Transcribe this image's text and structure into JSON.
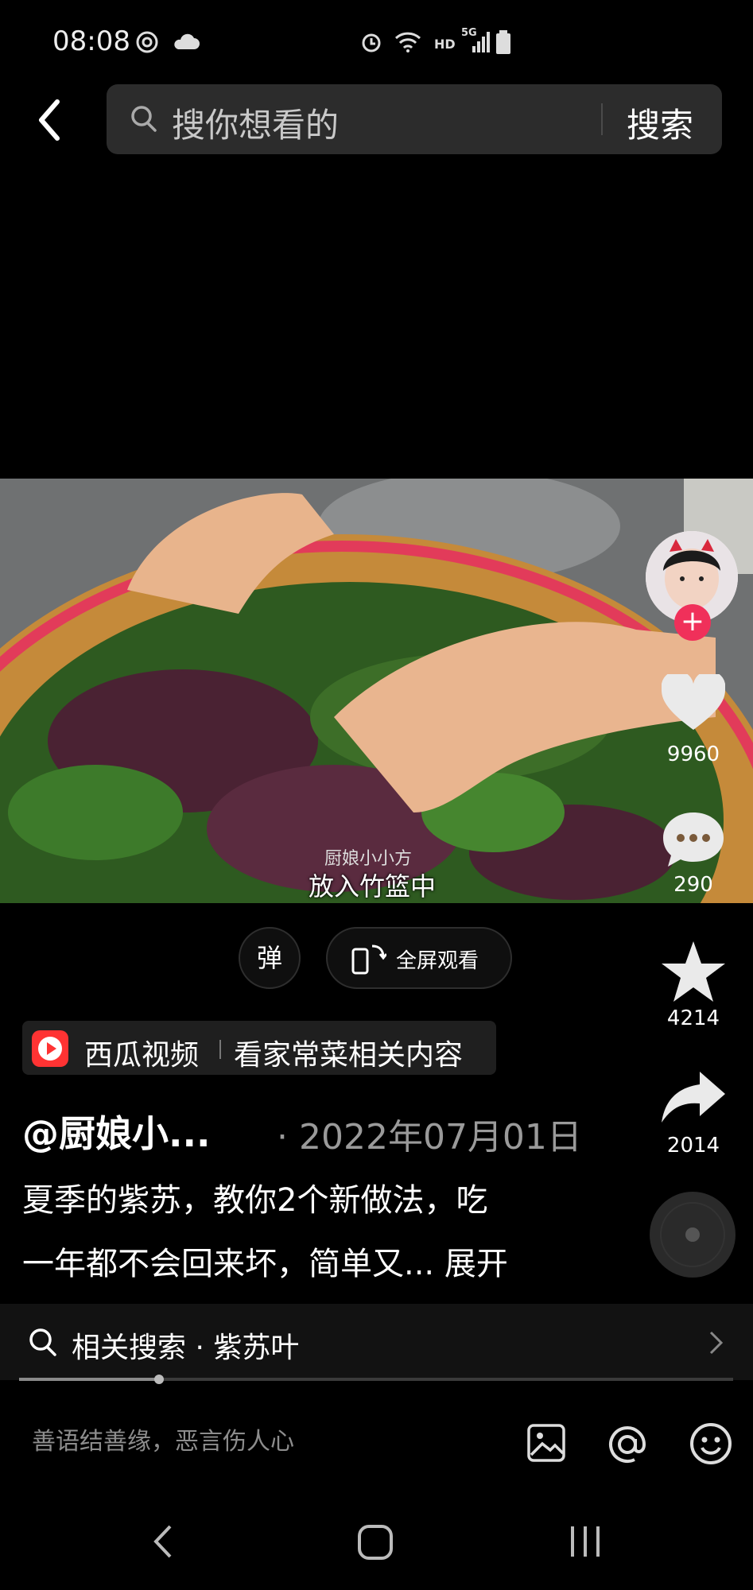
{
  "status_bar": {
    "time": "08:08",
    "net_label": "HD",
    "signal_label": "5G",
    "icons": [
      "messenger-icon",
      "cloud-icon",
      "alarm-icon",
      "wifi-icon",
      "signal-icon",
      "battery-icon"
    ]
  },
  "search": {
    "placeholder": "搜你想看的",
    "button": "搜索"
  },
  "video": {
    "watermark": "厨娘小小方",
    "subtitle": "放入竹篮中"
  },
  "side": {
    "likes": "9960",
    "comments": "290",
    "favorites": "4214",
    "shares": "2014"
  },
  "controls": {
    "danmu": "弹",
    "fullscreen": "全屏观看"
  },
  "xigua": {
    "app": "西瓜视频",
    "promo": "看家常菜相关内容"
  },
  "post": {
    "author": "@厨娘小...",
    "date": "· 2022年07月01日",
    "desc_line1": "夏季的紫苏，教你2个新做法，吃",
    "desc_line2": "一年都不会回来坏，简单又...",
    "expand": "展开"
  },
  "related": {
    "label": "相关搜索 · 紫苏叶"
  },
  "progress": {
    "fraction": 0.196
  },
  "comment_box": {
    "placeholder": "善语结善缘，恶言伤人心"
  },
  "colors": {
    "accent_red": "#f0305a",
    "bg": "#000000"
  }
}
